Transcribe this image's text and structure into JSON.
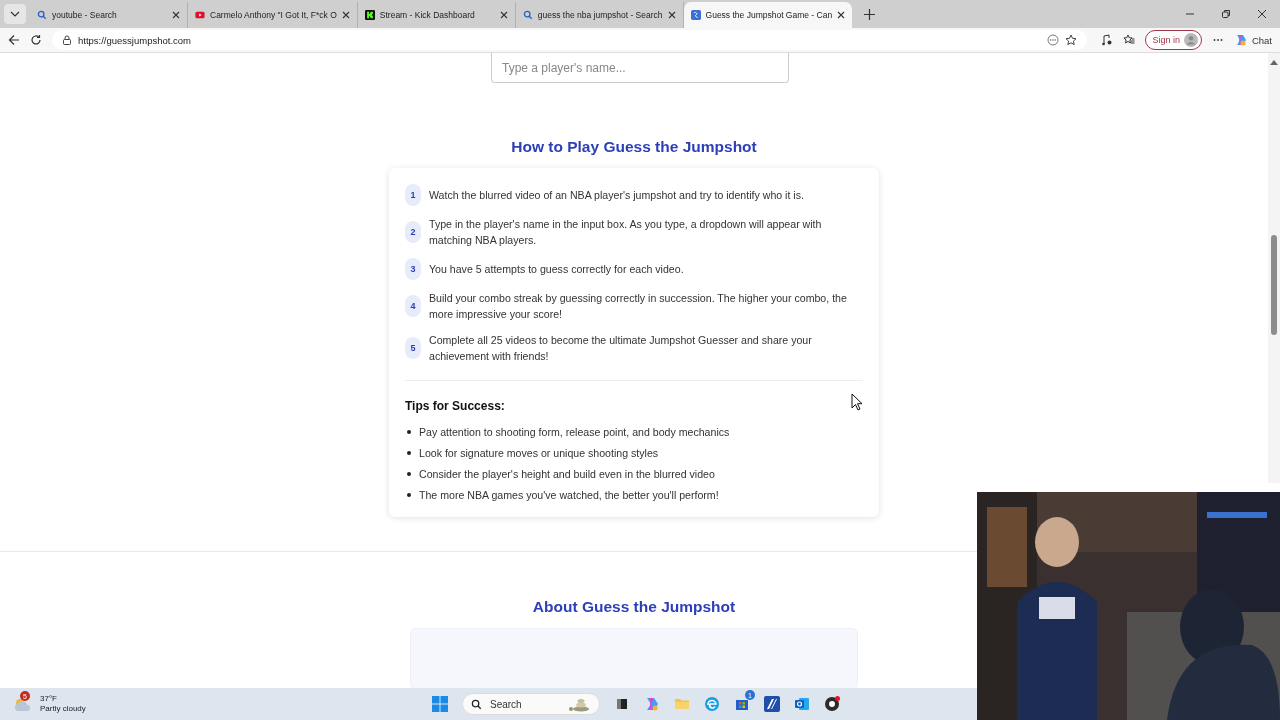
{
  "tabs": [
    {
      "title": "youtube - Search",
      "kind": "search",
      "selected": false
    },
    {
      "title": "Carmelo Anthony \"I Got It, F*ck O",
      "kind": "video",
      "selected": false
    },
    {
      "title": "Stream - Kick Dashboard",
      "kind": "kick",
      "selected": false
    },
    {
      "title": "guess the nba jumpshot - Search",
      "kind": "search",
      "selected": false
    },
    {
      "title": "Guess the Jumpshot Game - Can",
      "kind": "site",
      "selected": true
    }
  ],
  "address": "https://guessjumpshot.com",
  "sign_in": "Sign in",
  "chat": "Chat",
  "player_search": {
    "placeholder": "Type a player's name..."
  },
  "how_to": {
    "title": "How to Play Guess the Jumpshot",
    "steps": [
      {
        "number": "1",
        "text": "Watch the blurred video of an NBA player's jumpshot and try to identify who it is."
      },
      {
        "number": "2",
        "text": "Type in the player's name in the input box. As you type, a dropdown will appear with matching NBA players."
      },
      {
        "number": "3",
        "text": "You have 5 attempts to guess correctly for each video."
      },
      {
        "number": "4",
        "text": "Build your combo streak by guessing correctly in succession. The higher your combo, the more impressive your score!"
      },
      {
        "number": "5",
        "text": "Complete all 25 videos to become the ultimate Jumpshot Guesser and share your achievement with friends!"
      }
    ],
    "tips_title": "Tips for Success:",
    "tips": [
      "Pay attention to shooting form, release point, and body mechanics",
      "Look for signature moves or unique shooting styles",
      "Consider the player's height and build even in the blurred video",
      "The more NBA games you've watched, the better you'll perform!"
    ]
  },
  "about": {
    "title": "About Guess the Jumpshot"
  },
  "taskbar": {
    "weather_badge": "5",
    "temperature": "37°F",
    "condition": "Partly cloudy",
    "search": "Search",
    "store_badge": "1"
  }
}
